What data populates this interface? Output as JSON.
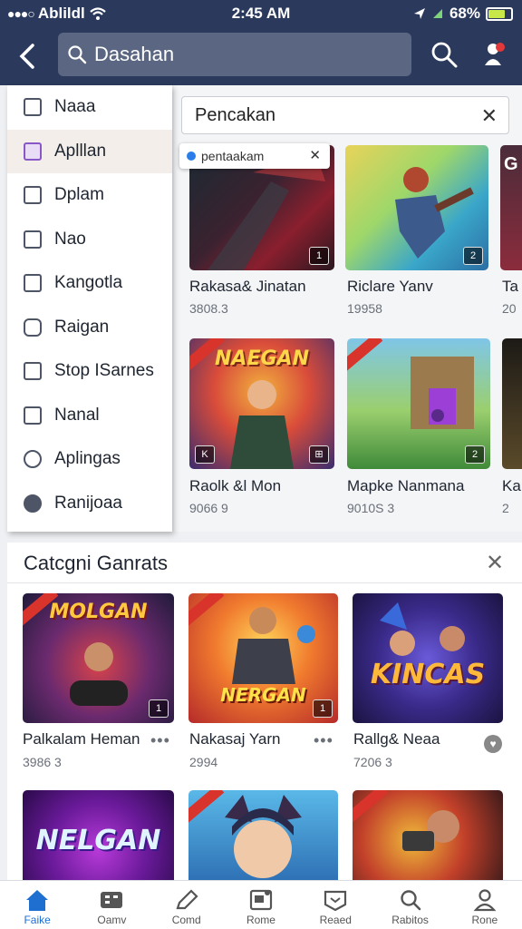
{
  "status": {
    "carrier": "Ablildl",
    "time": "2:45 AM",
    "battery": "68%"
  },
  "header": {
    "search_text": "Dasahan"
  },
  "dropdown": {
    "items": [
      {
        "label": "Naaa"
      },
      {
        "label": "Aplllan"
      },
      {
        "label": "Dplam"
      },
      {
        "label": "Nao"
      },
      {
        "label": "Kangotla"
      },
      {
        "label": "Raigan"
      },
      {
        "label": "Stop ISarnes"
      },
      {
        "label": "Nanal"
      },
      {
        "label": "Aplingas"
      },
      {
        "label": "Ranijoaa"
      }
    ]
  },
  "results": {
    "field_text": "Pencakan",
    "chip_text": "pentaakam",
    "games": [
      {
        "title": "Rakasa& Jinatan",
        "sub": "3808.3",
        "badge": "1"
      },
      {
        "title": "Riclare Yanv",
        "sub": "19958",
        "badge": "2"
      },
      {
        "title": "Ta",
        "sub": "20",
        "badge": ""
      },
      {
        "title": "Raolk &l Mon",
        "sub": "9066 9",
        "badge": "K",
        "art": "NAEGAN"
      },
      {
        "title": "Mapke Nanmana",
        "sub": "9010S 3",
        "badge": "2",
        "art": ""
      },
      {
        "title": "Ka",
        "sub": "2",
        "badge": ""
      }
    ]
  },
  "categories": {
    "title": "Catcgni Ganrats",
    "games": [
      {
        "title": "Palkalam Heman",
        "sub": "3986 3",
        "art": "MOLGAN",
        "badge": "1"
      },
      {
        "title": "Nakasaj Yarn",
        "sub": "2994",
        "art": "NERGAN",
        "badge": "1"
      },
      {
        "title": "Rallg& Neaa",
        "sub": "7206 3",
        "art": "KINCAS",
        "badge": ""
      },
      {
        "title": "",
        "sub": "",
        "art": "NELGAN"
      }
    ]
  },
  "bottom_nav": {
    "items": [
      {
        "label": "Faike"
      },
      {
        "label": "Oamv"
      },
      {
        "label": "Comd"
      },
      {
        "label": "Rome"
      },
      {
        "label": "Reaed"
      },
      {
        "label": "Rabitos"
      },
      {
        "label": "Rone"
      }
    ]
  }
}
